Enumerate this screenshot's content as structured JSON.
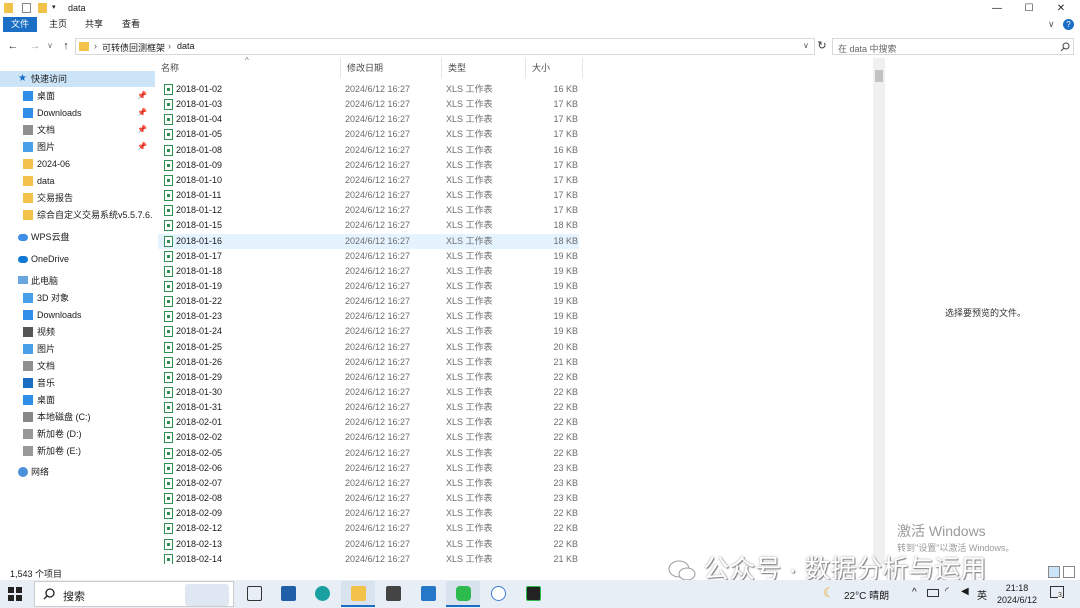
{
  "window": {
    "title": "data",
    "min": "—",
    "max": "☐",
    "close": "✕"
  },
  "ribbon": {
    "tabs": [
      "文件",
      "主页",
      "共享",
      "查看"
    ],
    "collapse": "∨",
    "help": "?"
  },
  "nav": {
    "back": "←",
    "forward": "→",
    "recent": "∨",
    "up": "↑",
    "breadcrumb": [
      "可转债回测框架",
      "data"
    ],
    "refresh": "↻",
    "search_placeholder": "在 data 中搜索"
  },
  "navpane": {
    "quick_access": "快速访问",
    "items": [
      {
        "label": "桌面",
        "pinned": true
      },
      {
        "label": "Downloads",
        "pinned": true
      },
      {
        "label": "文档",
        "pinned": true
      },
      {
        "label": "图片",
        "pinned": true
      },
      {
        "label": "2024-06",
        "pinned": false
      },
      {
        "label": "data",
        "pinned": false
      },
      {
        "label": "交易报告",
        "pinned": false
      },
      {
        "label": "综合自定义交易系统v5.5.7.6.",
        "pinned": false
      }
    ],
    "wps": "WPS云盘",
    "onedrive": "OneDrive",
    "this_pc": "此电脑",
    "pc_items": [
      "3D 对象",
      "Downloads",
      "视频",
      "图片",
      "文档",
      "音乐",
      "桌面",
      "本地磁盘 (C:)",
      "新加卷 (D:)",
      "新加卷 (E:)"
    ],
    "network": "网络",
    "pin_glyph": "📌"
  },
  "columns": {
    "name": "名称",
    "modified": "修改日期",
    "type": "类型",
    "size": "大小",
    "sort_glyph": "^"
  },
  "files": [
    {
      "name": "2018-01-02",
      "date": "2024/6/12 16:27",
      "type": "XLS 工作表",
      "size": "16 KB"
    },
    {
      "name": "2018-01-03",
      "date": "2024/6/12 16:27",
      "type": "XLS 工作表",
      "size": "17 KB"
    },
    {
      "name": "2018-01-04",
      "date": "2024/6/12 16:27",
      "type": "XLS 工作表",
      "size": "17 KB"
    },
    {
      "name": "2018-01-05",
      "date": "2024/6/12 16:27",
      "type": "XLS 工作表",
      "size": "17 KB"
    },
    {
      "name": "2018-01-08",
      "date": "2024/6/12 16:27",
      "type": "XLS 工作表",
      "size": "16 KB"
    },
    {
      "name": "2018-01-09",
      "date": "2024/6/12 16:27",
      "type": "XLS 工作表",
      "size": "17 KB"
    },
    {
      "name": "2018-01-10",
      "date": "2024/6/12 16:27",
      "type": "XLS 工作表",
      "size": "17 KB"
    },
    {
      "name": "2018-01-11",
      "date": "2024/6/12 16:27",
      "type": "XLS 工作表",
      "size": "17 KB"
    },
    {
      "name": "2018-01-12",
      "date": "2024/6/12 16:27",
      "type": "XLS 工作表",
      "size": "17 KB"
    },
    {
      "name": "2018-01-15",
      "date": "2024/6/12 16:27",
      "type": "XLS 工作表",
      "size": "18 KB"
    },
    {
      "name": "2018-01-16",
      "date": "2024/6/12 16:27",
      "type": "XLS 工作表",
      "size": "18 KB"
    },
    {
      "name": "2018-01-17",
      "date": "2024/6/12 16:27",
      "type": "XLS 工作表",
      "size": "19 KB"
    },
    {
      "name": "2018-01-18",
      "date": "2024/6/12 16:27",
      "type": "XLS 工作表",
      "size": "19 KB"
    },
    {
      "name": "2018-01-19",
      "date": "2024/6/12 16:27",
      "type": "XLS 工作表",
      "size": "19 KB"
    },
    {
      "name": "2018-01-22",
      "date": "2024/6/12 16:27",
      "type": "XLS 工作表",
      "size": "19 KB"
    },
    {
      "name": "2018-01-23",
      "date": "2024/6/12 16:27",
      "type": "XLS 工作表",
      "size": "19 KB"
    },
    {
      "name": "2018-01-24",
      "date": "2024/6/12 16:27",
      "type": "XLS 工作表",
      "size": "19 KB"
    },
    {
      "name": "2018-01-25",
      "date": "2024/6/12 16:27",
      "type": "XLS 工作表",
      "size": "20 KB"
    },
    {
      "name": "2018-01-26",
      "date": "2024/6/12 16:27",
      "type": "XLS 工作表",
      "size": "21 KB"
    },
    {
      "name": "2018-01-29",
      "date": "2024/6/12 16:27",
      "type": "XLS 工作表",
      "size": "22 KB"
    },
    {
      "name": "2018-01-30",
      "date": "2024/6/12 16:27",
      "type": "XLS 工作表",
      "size": "22 KB"
    },
    {
      "name": "2018-01-31",
      "date": "2024/6/12 16:27",
      "type": "XLS 工作表",
      "size": "22 KB"
    },
    {
      "name": "2018-02-01",
      "date": "2024/6/12 16:27",
      "type": "XLS 工作表",
      "size": "22 KB"
    },
    {
      "name": "2018-02-02",
      "date": "2024/6/12 16:27",
      "type": "XLS 工作表",
      "size": "22 KB"
    },
    {
      "name": "2018-02-05",
      "date": "2024/6/12 16:27",
      "type": "XLS 工作表",
      "size": "22 KB"
    },
    {
      "name": "2018-02-06",
      "date": "2024/6/12 16:27",
      "type": "XLS 工作表",
      "size": "23 KB"
    },
    {
      "name": "2018-02-07",
      "date": "2024/6/12 16:27",
      "type": "XLS 工作表",
      "size": "23 KB"
    },
    {
      "name": "2018-02-08",
      "date": "2024/6/12 16:27",
      "type": "XLS 工作表",
      "size": "23 KB"
    },
    {
      "name": "2018-02-09",
      "date": "2024/6/12 16:27",
      "type": "XLS 工作表",
      "size": "22 KB"
    },
    {
      "name": "2018-02-12",
      "date": "2024/6/12 16:27",
      "type": "XLS 工作表",
      "size": "22 KB"
    },
    {
      "name": "2018-02-13",
      "date": "2024/6/12 16:27",
      "type": "XLS 工作表",
      "size": "22 KB"
    },
    {
      "name": "2018-02-14",
      "date": "2024/6/12 16:27",
      "type": "XLS 工作表",
      "size": "21 KB"
    }
  ],
  "selected_file_index": 10,
  "preview": {
    "message": "选择要预览的文件。"
  },
  "activation": {
    "line1": "激活 Windows",
    "line2": "转到\"设置\"以激活 Windows。"
  },
  "status": {
    "count": "1,543 个项目"
  },
  "watermark": {
    "text": "公众号 · 数据分析与运用"
  },
  "taskbar": {
    "search_placeholder": "搜索",
    "apps": [
      "task-view",
      "mail",
      "edge",
      "file-explorer",
      "store",
      "vscode",
      "wechat",
      "app-bubbles",
      "terminal"
    ],
    "weather": "22°C 晴朗",
    "ime": "英",
    "time": "21:18",
    "date": "2024/6/12",
    "notifications": "3",
    "tray_up": "^"
  },
  "colors": {
    "accent": "#1a6fc4",
    "selection": "#cce4f7",
    "row_hover": "#e5f3ff",
    "excel_green": "#2f8f4e"
  }
}
